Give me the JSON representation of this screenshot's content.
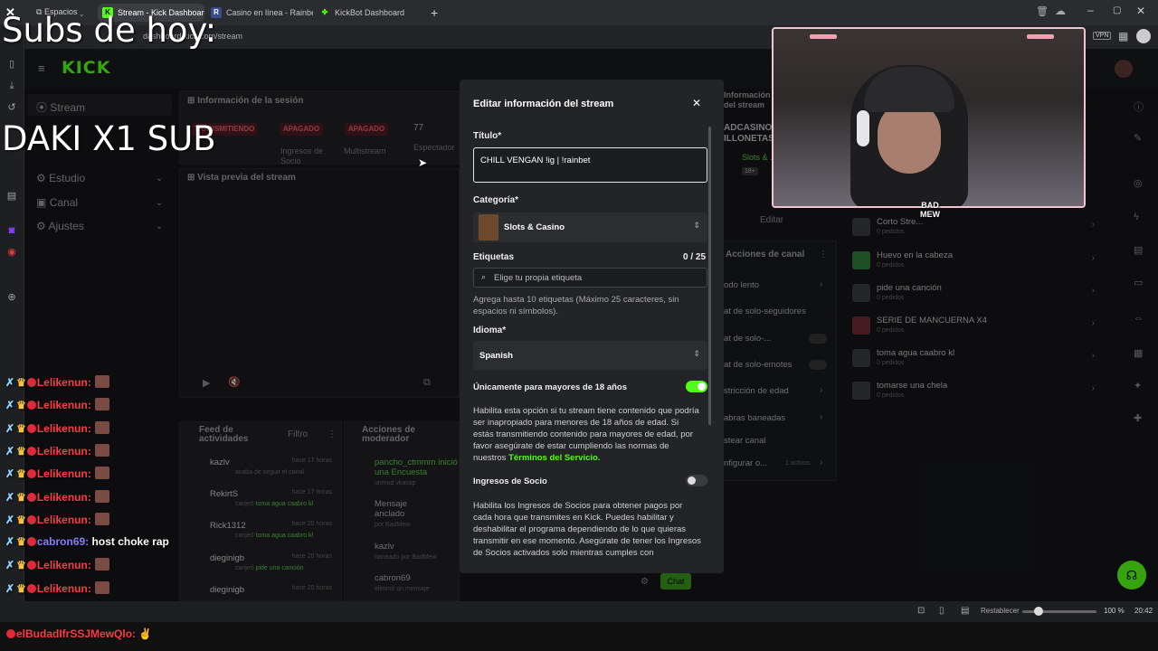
{
  "browser": {
    "workspaces_label": "Espacios",
    "tabs": [
      {
        "label": "Stream - Kick Dashboard",
        "icon": "kick-logo-icon",
        "active": true
      },
      {
        "label": "Casino en línea - Rainbet",
        "icon": "rainbet-logo-icon",
        "active": false
      },
      {
        "label": "KickBot Dashboard",
        "icon": "kickbot-logo-icon",
        "active": false
      }
    ],
    "address": "dashboard.kick.com/stream",
    "vpn_label": "VPN"
  },
  "kick": {
    "logo": "KICK",
    "nav": [
      {
        "label": "Stream"
      },
      {
        "label": "Estudio"
      },
      {
        "label": "Canal"
      },
      {
        "label": "Ajustes"
      }
    ],
    "session": {
      "title": "Información de la sesión",
      "items": [
        {
          "pill": "TRANSMITIENDO",
          "label": ""
        },
        {
          "pill": "APAGADO",
          "label": "Ingresos de Socio"
        },
        {
          "pill": "APAGADO",
          "label": "Multistream"
        },
        {
          "value": "77",
          "label": "Espectador"
        }
      ]
    },
    "preview_title": "Vista previa del stream",
    "feed": {
      "title": "Feed de actividades",
      "filter": "Filtro",
      "rows": [
        {
          "name": "kazlv",
          "sub": "acaba de seguir el canal",
          "highlight": "",
          "time": "hace 17 horas"
        },
        {
          "name": "RekirtS",
          "sub": "canjeó ",
          "highlight": "toma agua caabro kl",
          "time": "hace 17 horas"
        },
        {
          "name": "Rick1312",
          "sub": "canjeó ",
          "highlight": "toma agua caabro kl",
          "time": "hace 20 horas"
        },
        {
          "name": "dieginigb",
          "sub": "canjeó ",
          "highlight": "pide una canción",
          "time": "hace 20 horas"
        },
        {
          "name": "dieginigb",
          "sub": "",
          "highlight": "",
          "time": "hace 20 horas"
        }
      ]
    },
    "mod_actions": {
      "title": "Acciones de moderador",
      "rows": [
        {
          "title": "pancho_ctmmm inició una Encuesta",
          "sub": "unmod vkasap"
        },
        {
          "title": "Mensaje anclado",
          "sub": "por BadMew"
        },
        {
          "title": "kazlv",
          "sub": "baneado por BadMew"
        },
        {
          "title": "cabron69",
          "sub": "eliminó un mensaje"
        }
      ]
    },
    "chat_button": "Chat",
    "right_info": {
      "title": "Información del stream",
      "line1": "ADCASINO",
      "line2": "ILLONETAS",
      "category": "Slots & ...",
      "badge": "18+",
      "edit": "Editar"
    },
    "channel_actions": {
      "title": "Acciones de canal",
      "items": [
        "odo lento",
        "at de solo-seguidores",
        "at de solo-...",
        "at de solo-emotes",
        "stricción de edad",
        "abras baneadas",
        "stear canal",
        "nfigurar o..."
      ],
      "active_count": "1 activos"
    },
    "rewards": [
      {
        "title": "Corto Stre...",
        "sub": "0 pedidos"
      },
      {
        "title": "Huevo en la cabeza",
        "sub": "0 pedidos"
      },
      {
        "title": "pide una canción",
        "sub": "0 pedidos"
      },
      {
        "title": "SERIE DE MANCUERNA X4",
        "sub": "0 pedidos"
      },
      {
        "title": "toma agua caabro kl",
        "sub": "0 pedidos"
      },
      {
        "title": "tomarse una chela",
        "sub": "0 pedidos"
      }
    ]
  },
  "modal": {
    "title": "Editar información del stream",
    "title_label": "Título*",
    "title_value": "CHILL VENGAN !ig | !rainbet",
    "category_label": "Categoría*",
    "category_value": "Slots & Casino",
    "tags_label": "Etiquetas",
    "tags_count": "0 / 25",
    "tags_placeholder": "Elige tu propia etiqueta",
    "tags_help": "Agrega hasta 10 etiquetas (Máximo 25 caracteres, sin espacios ni símbolos).",
    "language_label": "Idioma*",
    "language_value": "Spanish",
    "adult_label": "Únicamente para mayores de 18 años",
    "adult_on": true,
    "adult_help": "Habilita esta opción si tu stream tiene contenido que podría ser inapropiado para menores de 18 años de edad. Si estás transmitiendo contenido para mayores de edad, por favor asegúrate de estar cumpliendo las normas de nuestros ",
    "terms_link": "Términos del Servicio.",
    "partner_label": "Ingresos de Socio",
    "partner_on": false,
    "partner_help": "Habilita los Ingresos de Socios para obtener pagos por cada hora que transmites en Kick. Puedes habilitar y deshabilitar el programa dependiendo de lo que quieras transmitir en ese momento. Asegúrate de tener los Ingresos de Socios activados solo mientras cumples con"
  },
  "overlay": {
    "subs_text": "Subs de hoy:",
    "daki_text": "DAKI X1 SUB",
    "cam_logo": "BAD MEW",
    "chat": [
      {
        "user": "Lelikenun:",
        "msg": "",
        "color": "#ff3b48"
      },
      {
        "user": "Lelikenun:",
        "msg": "",
        "color": "#ff3b48"
      },
      {
        "user": "Lelikenun:",
        "msg": "",
        "color": "#ff3b48"
      },
      {
        "user": "Lelikenun:",
        "msg": "",
        "color": "#ff3b48"
      },
      {
        "user": "Lelikenun:",
        "msg": "",
        "color": "#ff3b48"
      },
      {
        "user": "Lelikenun:",
        "msg": "",
        "color": "#ff3b48"
      },
      {
        "user": "Lelikenun:",
        "msg": "",
        "color": "#ff3b48"
      },
      {
        "user": "cabron69:",
        "msg": "host choke rap",
        "color": "#8a7cff"
      },
      {
        "user": "Lelikenun:",
        "msg": "",
        "color": "#ff3b48"
      },
      {
        "user": "Lelikenun:",
        "msg": "",
        "color": "#ff3b48"
      },
      {
        "user": "Lelikenun:",
        "msg": "",
        "color": "#ff3b48"
      }
    ],
    "bottom_user": "elBudadIfrSSJMewQlo:"
  },
  "statusbar": {
    "reset": "Restablecer",
    "zoom": "100 %",
    "time": "20:42"
  },
  "colors": {
    "kick_green": "#53fc18",
    "modal_bg": "#232428",
    "toggle_on": "#53fc18"
  }
}
